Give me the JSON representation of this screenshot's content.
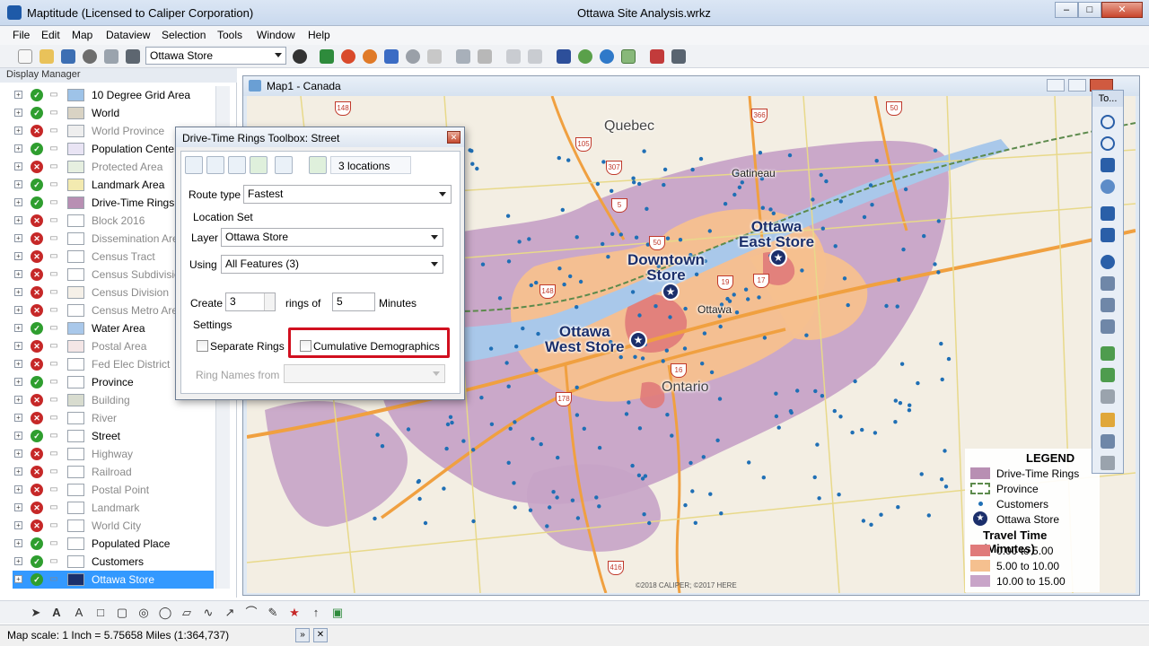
{
  "app": {
    "title": "Maptitude (Licensed to Caliper Corporation)",
    "document": "Ottawa Site Analysis.wrkz",
    "window_buttons": [
      "–",
      "□",
      "✕"
    ]
  },
  "menu": [
    "File",
    "Edit",
    "Map",
    "Dataview",
    "Selection",
    "Tools",
    "Window",
    "Help"
  ],
  "toolbar": {
    "layer_select_value": "Ottawa Store"
  },
  "display_manager": {
    "title": "Display Manager",
    "layers": [
      {
        "name": "10 Degree Grid Area",
        "visible": true,
        "swatch": "#9ec3e8",
        "dim": false
      },
      {
        "name": "World",
        "visible": true,
        "swatch": "#d9d3c4",
        "dim": false
      },
      {
        "name": "World Province",
        "visible": false,
        "swatch": "#eeeeee",
        "dim": true
      },
      {
        "name": "Population Centers",
        "visible": true,
        "swatch": "#e9e4f4",
        "dim": false
      },
      {
        "name": "Protected Area",
        "visible": false,
        "swatch": "#e6efe0",
        "dim": true
      },
      {
        "name": "Landmark Area",
        "visible": true,
        "swatch": "#f3eab0",
        "dim": false
      },
      {
        "name": "Drive-Time Rings",
        "visible": true,
        "swatch": "#b88fb3",
        "dim": false
      },
      {
        "name": "Block 2016",
        "visible": false,
        "swatch": "#ffffff",
        "dim": true
      },
      {
        "name": "Dissemination Area",
        "visible": false,
        "swatch": "#ffffff",
        "dim": true
      },
      {
        "name": "Census Tract",
        "visible": false,
        "swatch": "#ffffff",
        "dim": true
      },
      {
        "name": "Census Subdivision",
        "visible": false,
        "swatch": "#ffffff",
        "dim": true
      },
      {
        "name": "Census Division",
        "visible": false,
        "swatch": "#f5f0e8",
        "dim": true
      },
      {
        "name": "Census Metro Area",
        "visible": false,
        "swatch": "#ffffff",
        "dim": true
      },
      {
        "name": "Water Area",
        "visible": true,
        "swatch": "#a9c8ea",
        "dim": false
      },
      {
        "name": "Postal Area",
        "visible": false,
        "swatch": "#f4e6e6",
        "dim": true
      },
      {
        "name": "Fed Elec District",
        "visible": false,
        "swatch": "#ffffff",
        "dim": true
      },
      {
        "name": "Province",
        "visible": true,
        "swatch": "#ffffff",
        "dim": false
      },
      {
        "name": "Building",
        "visible": false,
        "swatch": "#d8dccf",
        "dim": true
      },
      {
        "name": "River",
        "visible": false,
        "swatch": "#ffffff",
        "dim": true
      },
      {
        "name": "Street",
        "visible": true,
        "swatch": "#ffffff",
        "dim": false
      },
      {
        "name": "Highway",
        "visible": false,
        "swatch": "#ffffff",
        "dim": true
      },
      {
        "name": "Railroad",
        "visible": false,
        "swatch": "#ffffff",
        "dim": true
      },
      {
        "name": "Postal Point",
        "visible": false,
        "swatch": "#ffffff",
        "dim": true
      },
      {
        "name": "Landmark",
        "visible": false,
        "swatch": "#ffffff",
        "dim": true
      },
      {
        "name": "World City",
        "visible": false,
        "swatch": "#ffffff",
        "dim": true
      },
      {
        "name": "Populated Place",
        "visible": true,
        "swatch": "#ffffff",
        "dim": false
      },
      {
        "name": "Customers",
        "visible": true,
        "swatch": "#ffffff",
        "dim": false
      },
      {
        "name": "Ottawa Store",
        "visible": true,
        "swatch": "#1b2f6b",
        "dim": false
      }
    ]
  },
  "map": {
    "title": "Map1 - Canada",
    "labels": {
      "quebec": "Quebec",
      "gatineau": "Gatineau",
      "ottawa": "Ottawa",
      "ontario": "Ontario",
      "downtown_store": "Downtown\nStore",
      "east_store": "Ottawa\nEast Store",
      "west_store": "Ottawa\nWest Store"
    },
    "shields": [
      "148",
      "366",
      "50",
      "105",
      "307",
      "5",
      "50",
      "19",
      "17",
      "148",
      "16",
      "178",
      "416"
    ],
    "copyright": "©2018 CALIPER; ©2017 HERE"
  },
  "legend": {
    "title": "LEGEND",
    "items": [
      {
        "label": "Drive-Time Rings",
        "color": "#b88fb3"
      },
      {
        "label": "Province",
        "color": "#5c8a4c"
      },
      {
        "label": "Customers",
        "color": "#1f6fb5"
      },
      {
        "label": "Ottawa Store",
        "color": "#1b2f6b"
      }
    ],
    "travel_title": "Travel Time (Minutes)",
    "travel_items": [
      {
        "label": "0.00 to 5.00",
        "color": "#e07a7a"
      },
      {
        "label": "5.00 to 10.00",
        "color": "#f5c08f"
      },
      {
        "label": "10.00 to 15.00",
        "color": "#c8a4c8"
      }
    ]
  },
  "right_toolbox": {
    "title": "To..."
  },
  "dialog": {
    "title": "Drive-Time Rings Toolbox: Street",
    "locations": "3 locations",
    "route_type_label": "Route type",
    "route_type_value": "Fastest",
    "location_set_label": "Location Set",
    "layer_label": "Layer",
    "layer_value": "Ottawa Store",
    "using_label": "Using",
    "using_value": "All Features (3)",
    "create_label": "Create",
    "create_value": "3",
    "rings_of_label": "rings of",
    "minutes_value": "5",
    "minutes_label": "Minutes",
    "settings_label": "Settings",
    "separate_rings_label": "Separate Rings",
    "cumulative_label": "Cumulative Demographics",
    "ring_names_label": "Ring Names from"
  },
  "status": {
    "scale": "Map scale: 1 Inch = 5.75658 Miles (1:364,737)"
  }
}
